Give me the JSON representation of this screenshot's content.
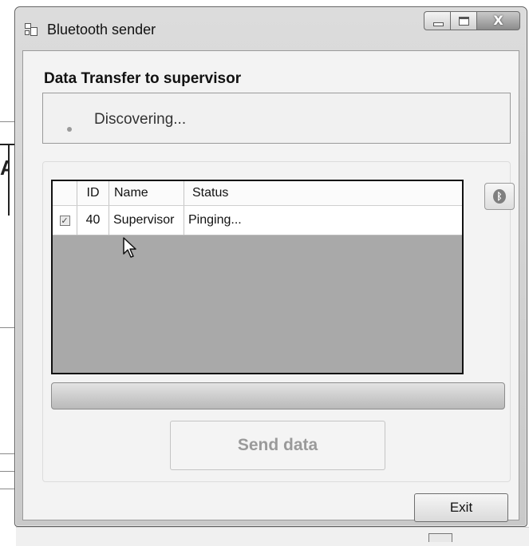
{
  "window": {
    "title": "Bluetooth sender",
    "caption_buttons": {
      "minimize_icon": "minimize-icon",
      "maximize_icon": "maximize-icon",
      "close_label": "X"
    }
  },
  "main": {
    "heading": "Data Transfer to supervisor",
    "status_text": "Discovering...",
    "bluetooth_icon": "bluetooth-icon"
  },
  "grid": {
    "columns": [
      "",
      "ID",
      "Name",
      "Status"
    ],
    "rows": [
      {
        "checked": true,
        "id": "40",
        "name": "Supervisor",
        "status": "Pinging..."
      }
    ]
  },
  "progress": {
    "value": 0
  },
  "buttons": {
    "send_label": "Send data",
    "exit_label": "Exit"
  },
  "colors": {
    "grid_background": "#a9a9a9",
    "disabled_text": "#9a9a9a"
  }
}
